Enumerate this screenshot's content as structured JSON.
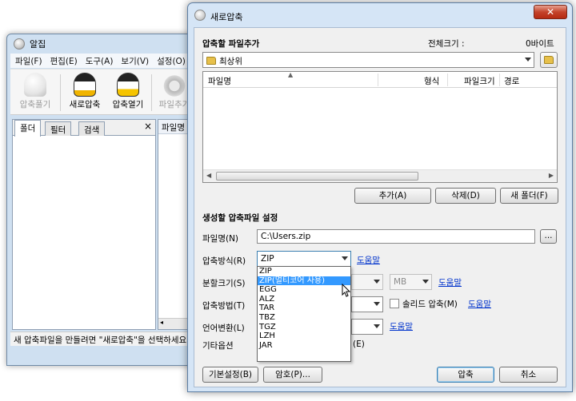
{
  "main_window": {
    "title": "알집",
    "menu": [
      "파일(F)",
      "편집(E)",
      "도구(A)",
      "보기(V)",
      "설정(O)"
    ],
    "toolbar": {
      "extract": "압축풀기",
      "new_archive": "새로압축",
      "open_archive": "압축열기",
      "add_file": "파일추가"
    },
    "tabs": [
      "폴더",
      "필터",
      "검색"
    ],
    "close_tab": "×",
    "file_column_header": "파일명",
    "status_text": "새 압축파일을 만들려면 \"새로압축\"을 선택하세요"
  },
  "dialog": {
    "title": "새로압축",
    "close_glyph": "✕",
    "section_add": {
      "label": "압축할 파일추가",
      "total_size_label": "전체크기 :",
      "total_size_value": "0바이트",
      "location": "최상위"
    },
    "file_list": {
      "columns": [
        "파일명",
        "형식",
        "파일크기",
        "경로"
      ],
      "rows": []
    },
    "list_buttons": {
      "add": "추가(A)",
      "delete": "삭제(D)",
      "new_folder": "새 폴더(F)"
    },
    "section_settings": {
      "label": "생성할 압축파일 설정",
      "filename_label": "파일명(N)",
      "filename_value": "C:\\Users.zip",
      "browse": "...",
      "method_label": "압축방식(R)",
      "method_value": "ZIP",
      "help": "도움말",
      "split_label": "분할크기(S)",
      "split_unit": "MB",
      "compress_label": "압축방법(T)",
      "solid_label": "솔리드 압축(M)",
      "lang_label": "언어변환(L)",
      "other_label": "기타옵션",
      "other_suffix": "(E)"
    },
    "method_options": [
      "ZIP",
      "ZIP(멀티코어 사용)",
      "EGG",
      "ALZ",
      "TAR",
      "TBZ",
      "TGZ",
      "LZH",
      "JAR"
    ],
    "method_highlighted": "ZIP(멀티코어 사용)",
    "bottom_buttons": {
      "preferences": "기본설정(B)",
      "password": "암호(P)...",
      "compress": "압축",
      "cancel": "취소"
    }
  }
}
